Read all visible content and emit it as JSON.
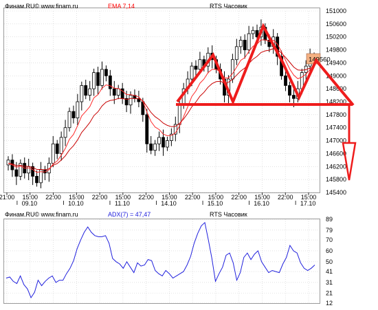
{
  "top_panel": {
    "source_label": "Финам.RU© www.finam.ru",
    "indicator_label": "EMA 7,14",
    "instrument_label": "RTS Часовик",
    "price_badge": "149560"
  },
  "bottom_panel": {
    "source_label": "Финам.RU© www.finam.ru",
    "indicator_label": "ADX(7) = 47,47",
    "instrument_label": "RTS Часовик"
  },
  "colors": {
    "candle": "#000000",
    "ema_fast": "#ff2a2a",
    "ema_slow": "#c80000",
    "pattern": "#ee1c1c",
    "adx_line": "#2020dd",
    "grid": "#c8c8c8",
    "badge_fill": "#f4b183",
    "indicator_text": "#ff0000"
  },
  "chart_data": [
    {
      "type": "candlestick",
      "ylim": [
        145400,
        151000
      ],
      "y_ticks": [
        "151000",
        "150600",
        "150200",
        "149800",
        "149400",
        "149000",
        "148600",
        "148200",
        "147800",
        "147400",
        "147000",
        "146600",
        "146200",
        "145800",
        "145400"
      ],
      "x_time_ticks": [
        "21:00",
        "15:00",
        "22:00",
        "15:00",
        "22:00",
        "15:00",
        "22:00",
        "15:00",
        "22:00",
        "15:00",
        "22:00",
        "15:00",
        "22:00",
        "15:00"
      ],
      "x_date_ticks": [
        "09.10",
        "10.10",
        "11.10",
        "14.10",
        "15.10",
        "16.10",
        "17.10"
      ],
      "close_series": [
        146400,
        146100,
        145900,
        146300,
        146000,
        146200,
        145900,
        145700,
        146100,
        146000,
        146300,
        146900,
        146600,
        147100,
        147400,
        147900,
        147700,
        148200,
        148700,
        148400,
        148600,
        149100,
        148700,
        149200,
        149000,
        148600,
        148400,
        148600,
        148300,
        148100,
        148400,
        148300,
        148200,
        147800,
        146900,
        146700,
        146900,
        147100,
        146800,
        147000,
        147200,
        147500,
        148100,
        148600,
        148900,
        149300,
        149200,
        149500,
        149300,
        149700,
        149500,
        149200,
        148900,
        148400,
        148900,
        149500,
        149900,
        150100,
        149800,
        150300,
        150400,
        150200,
        150500,
        150100,
        149900,
        150200,
        149600,
        149000,
        148700,
        148400,
        148300,
        148600,
        149100,
        149300,
        149600,
        149500
      ],
      "ema_fast": [
        146300,
        146250,
        146180,
        146210,
        146150,
        146160,
        146110,
        146020,
        146040,
        146030,
        146100,
        146280,
        146370,
        146550,
        146760,
        147040,
        147190,
        147460,
        147760,
        147900,
        148050,
        148320,
        148420,
        148620,
        148720,
        148690,
        148620,
        148610,
        148530,
        148420,
        148420,
        148390,
        148350,
        148210,
        147880,
        147590,
        147420,
        147340,
        147200,
        147150,
        147160,
        147240,
        147450,
        147740,
        148040,
        148360,
        148530,
        148770,
        148900,
        149100,
        149200,
        149200,
        149120,
        148940,
        148930,
        149070,
        149270,
        149480,
        149560,
        149750,
        149910,
        149980,
        150110,
        150110,
        150060,
        150100,
        149980,
        149740,
        149480,
        149210,
        149020,
        148910,
        148960,
        149050,
        149190,
        149270
      ],
      "ema_slow": [
        146300,
        146280,
        146230,
        146240,
        146210,
        146200,
        146170,
        146110,
        146110,
        146100,
        146130,
        146240,
        146290,
        146400,
        146530,
        146710,
        146840,
        147020,
        147250,
        147400,
        147560,
        147770,
        147890,
        148070,
        148190,
        148240,
        148260,
        148300,
        148300,
        148270,
        148300,
        148300,
        148290,
        148230,
        148050,
        147870,
        147740,
        147650,
        147540,
        147470,
        147430,
        147440,
        147530,
        147670,
        147840,
        148040,
        148190,
        148370,
        148490,
        148650,
        148760,
        148820,
        148830,
        148780,
        148800,
        148890,
        149020,
        149150,
        149240,
        149380,
        149510,
        149600,
        149720,
        149770,
        149790,
        149840,
        149810,
        149700,
        149570,
        149420,
        149270,
        149180,
        149170,
        149190,
        149240,
        149280
      ]
    },
    {
      "type": "line",
      "title": "ADX(7) = 47,47",
      "ylim": [
        12,
        89
      ],
      "y_ticks": [
        "89",
        "79",
        "70",
        "60",
        "50",
        "41",
        "31",
        "21",
        "12"
      ],
      "series": [
        {
          "values": [
            35,
            36,
            32,
            30,
            37,
            29,
            25,
            17,
            22,
            33,
            28,
            32,
            35,
            37,
            31,
            33,
            33,
            39,
            44,
            51,
            62,
            70,
            77,
            82,
            77,
            74,
            73,
            73,
            74,
            67,
            53,
            50,
            48,
            44,
            50,
            45,
            40,
            49,
            46,
            47,
            52,
            51,
            42,
            39,
            37,
            42,
            39,
            35,
            37,
            39,
            41,
            47,
            55,
            67,
            76,
            83,
            86,
            70,
            53,
            32,
            39,
            45,
            56,
            58,
            49,
            33,
            40,
            54,
            58,
            52,
            57,
            60,
            50,
            45,
            40,
            42,
            41,
            40,
            48,
            54,
            65,
            60,
            58,
            49,
            44,
            42,
            44,
            47
          ]
        }
      ]
    }
  ]
}
